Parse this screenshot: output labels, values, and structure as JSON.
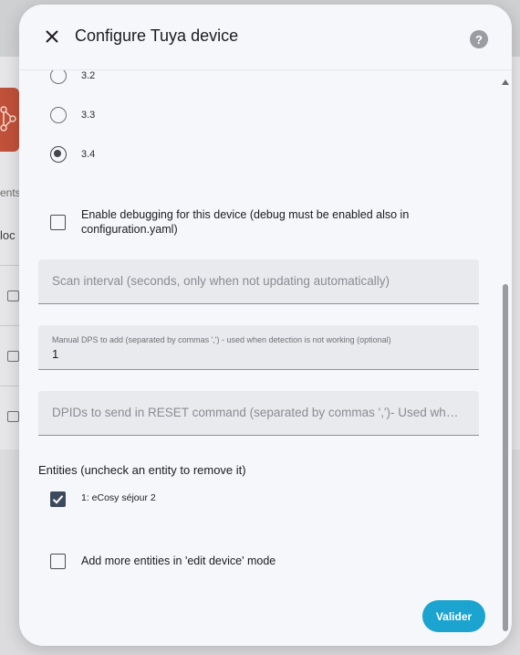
{
  "background": {
    "partial_text_1": "ents",
    "partial_text_2": "loc"
  },
  "dialog": {
    "title": "Configure Tuya device",
    "close_icon": "close-icon",
    "help_icon": "help-icon",
    "help_glyph": "?"
  },
  "protocol_options": [
    {
      "label": "3.2",
      "checked": false
    },
    {
      "label": "3.3",
      "checked": false
    },
    {
      "label": "3.4",
      "checked": true
    }
  ],
  "debug_checkbox": {
    "label_line1": "Enable debugging for this device (debug must be enabled also in",
    "label_line2": "configuration.yaml)",
    "checked": false
  },
  "scan_interval": {
    "placeholder": "Scan interval (seconds, only when not updating automatically)",
    "value": ""
  },
  "manual_dps": {
    "label": "Manual DPS to add (separated by commas ',') - used when detection is not working (optional)",
    "value": "1"
  },
  "reset_dpids": {
    "placeholder": "DPIDs to send in RESET command (separated by commas ',')- Used when devi...",
    "value": ""
  },
  "entities": {
    "section_label": "Entities (uncheck an entity to remove it)",
    "items": [
      {
        "label": "1: eCosy séjour 2",
        "checked": true
      }
    ]
  },
  "add_more": {
    "label": "Add more entities in 'edit device' mode",
    "checked": false
  },
  "submit_label": "Valider",
  "colors": {
    "accent": "#1ba4cf",
    "dialog_bg": "#f6f7fb",
    "field_bg": "#e9eaee",
    "checkbox_checked": "#3c4a5c"
  }
}
